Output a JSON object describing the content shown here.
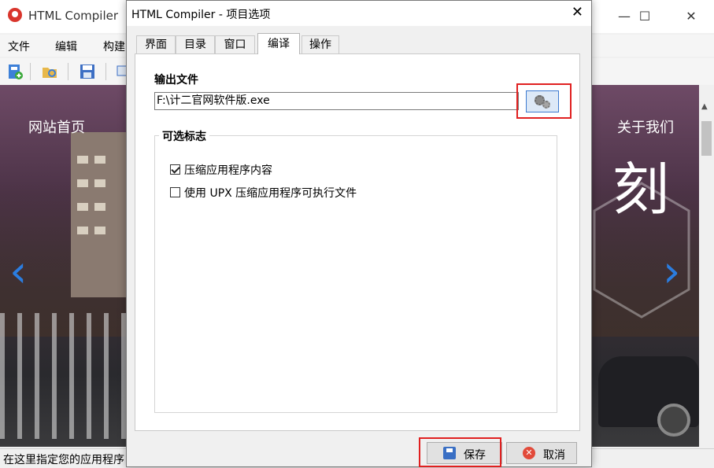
{
  "main_window": {
    "title": "HTML Compiler",
    "controls": {
      "minimize": "—",
      "maximize": "☐",
      "close": "✕"
    },
    "menu": [
      "文件",
      "编辑",
      "构建"
    ],
    "toolbar_icons": [
      "new-project-icon",
      "open-folder-icon",
      "save-icon",
      "preview-icon"
    ],
    "preview": {
      "nav_home": "网站首页",
      "nav_about": "关于我们",
      "logo_char": "刻"
    },
    "status_text": "在这里指定您的应用程序"
  },
  "dialog": {
    "title": "HTML Compiler - 项目选项",
    "close": "✕",
    "tabs": [
      {
        "label": "界面",
        "active": false
      },
      {
        "label": "目录",
        "active": false
      },
      {
        "label": "窗口",
        "active": false
      },
      {
        "label": "编译",
        "active": true
      },
      {
        "label": "操作",
        "active": false
      }
    ],
    "output": {
      "label": "输出文件",
      "value": "F:\\计二官网软件版.exe"
    },
    "options": {
      "label": "可选标志",
      "items": [
        {
          "label": "压缩应用程序内容",
          "checked": true
        },
        {
          "label": "使用 UPX 压缩应用程序可执行文件",
          "checked": false
        }
      ]
    },
    "buttons": {
      "save": "保存",
      "cancel": "取消"
    }
  },
  "colors": {
    "highlight": "#e02020",
    "accent": "#2b7de0"
  }
}
